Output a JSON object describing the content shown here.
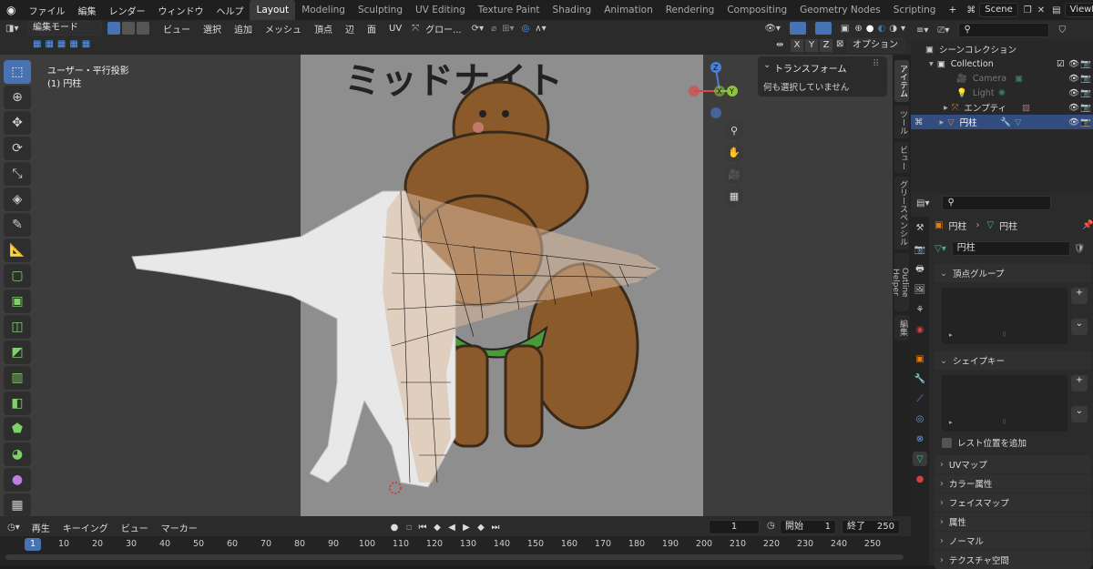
{
  "topbar": {
    "menus": [
      "ファイル",
      "編集",
      "レンダー",
      "ウィンドウ",
      "ヘルプ"
    ],
    "workspaces": [
      "Layout",
      "Modeling",
      "Sculpting",
      "UV Editing",
      "Texture Paint",
      "Shading",
      "Animation",
      "Rendering",
      "Compositing",
      "Geometry Nodes",
      "Scripting"
    ],
    "active_workspace": "Layout",
    "add_tab": "+",
    "scene": "Scene",
    "view_layer": "ViewLayer"
  },
  "viewport_header": {
    "mode": "編集モード",
    "menus": [
      "ビュー",
      "選択",
      "追加",
      "メッシュ",
      "頂点",
      "辺",
      "面",
      "UV"
    ],
    "transform_orientation": "グロー...",
    "options": "オプション",
    "axes": [
      "X",
      "Y",
      "Z"
    ]
  },
  "viewport": {
    "view_name": "ユーザー・平行投影",
    "object_label": "(1) 円柱",
    "image_text": "ミッドナイト",
    "nav_axes": {
      "z": "Z",
      "y": "Y",
      "x": "X"
    }
  },
  "transform_panel": {
    "title": "トランスフォーム",
    "message": "何も選択していません"
  },
  "sidebar_tabs": [
    "アイテム",
    "ツール",
    "ビュー",
    "グリースペンシル",
    "Outline Helper",
    "編集"
  ],
  "outliner": {
    "root": "シーンコレクション",
    "collection": "Collection",
    "items": [
      {
        "name": "Camera",
        "dim": true
      },
      {
        "name": "Light",
        "dim": true
      },
      {
        "name": "エンプティ",
        "dim": false
      },
      {
        "name": "円柱",
        "dim": false,
        "selected": true
      }
    ]
  },
  "properties": {
    "breadcrumb_object": "円柱",
    "breadcrumb_data": "円柱",
    "data_name": "円柱",
    "panels": {
      "vertex_groups": "頂点グループ",
      "shape_keys": "シェイプキー",
      "add_rest_position": "レスト位置を追加",
      "uv_maps": "UVマップ",
      "color_attributes": "カラー属性",
      "face_maps": "フェイスマップ",
      "attributes": "属性",
      "normals": "ノーマル",
      "texture_space": "テクスチャ空間"
    }
  },
  "timeline": {
    "menus": [
      "再生",
      "キーイング",
      "ビュー",
      "マーカー"
    ],
    "current_frame": "1",
    "start_label": "開始",
    "start": "1",
    "end_label": "終了",
    "end": "250",
    "ruler": [
      "1",
      "10",
      "20",
      "30",
      "40",
      "50",
      "60",
      "70",
      "80",
      "90",
      "100",
      "110",
      "120",
      "130",
      "140",
      "150",
      "160",
      "170",
      "180",
      "190",
      "200",
      "210",
      "220",
      "230",
      "240",
      "250"
    ]
  },
  "colors": {
    "accent": "#4772b3",
    "vertex_group_icon": "#3bb3a3",
    "orange": "#e87d0d"
  }
}
